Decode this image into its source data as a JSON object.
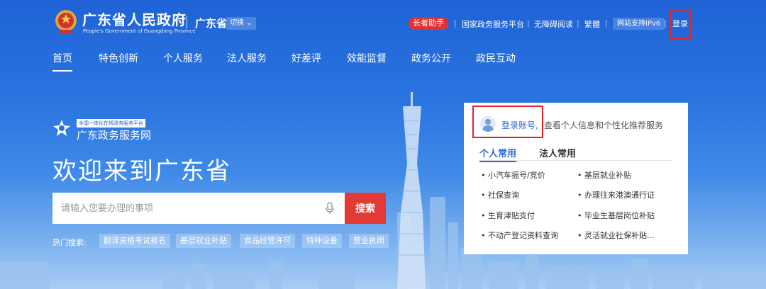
{
  "header": {
    "gov_title": "广东省人民政府",
    "gov_subtitle": "People's Government of Guangdong Province",
    "region": "广东省",
    "switch_label": "切换",
    "elder_assistant": "长者助手",
    "links": [
      "国家政务服务平台",
      "无障碍阅读",
      "繁體"
    ],
    "ipv6_label": "网站支持IPv6",
    "login": "登录"
  },
  "nav": {
    "items": [
      "首页",
      "特色创新",
      "个人服务",
      "法人服务",
      "好差评",
      "效能监督",
      "政务公开",
      "政民互动"
    ],
    "active_index": 0
  },
  "hero": {
    "portal_tag": "全国一体化在线政务服务平台",
    "portal_name": "广东政务服务网",
    "welcome": "欢迎来到广东省"
  },
  "search": {
    "placeholder": "请输入您要办理的事项",
    "button": "搜索"
  },
  "hot": {
    "label": "热门搜索:",
    "tags": [
      "翻译资格考试报名",
      "基层就业补贴",
      "食品经营许可",
      "特种设备",
      "营业执照"
    ]
  },
  "panel": {
    "login_link": "登录账号,",
    "login_desc": "查看个人信息和个性化推荐服务",
    "tabs": [
      "个人常用",
      "法人常用"
    ],
    "active_tab": 0,
    "services": [
      [
        "小汽车摇号/竞价",
        "基层就业补贴"
      ],
      [
        "社保查询",
        "办理往来港澳通行证"
      ],
      [
        "生育津贴支付",
        "毕业生基层岗位补贴"
      ],
      [
        "不动产登记资料查询",
        "灵活就业社保补贴..."
      ]
    ]
  },
  "colors": {
    "primary_blue": "#1f63d6",
    "accent_red": "#e23a35",
    "link_blue": "#2c69d4"
  }
}
